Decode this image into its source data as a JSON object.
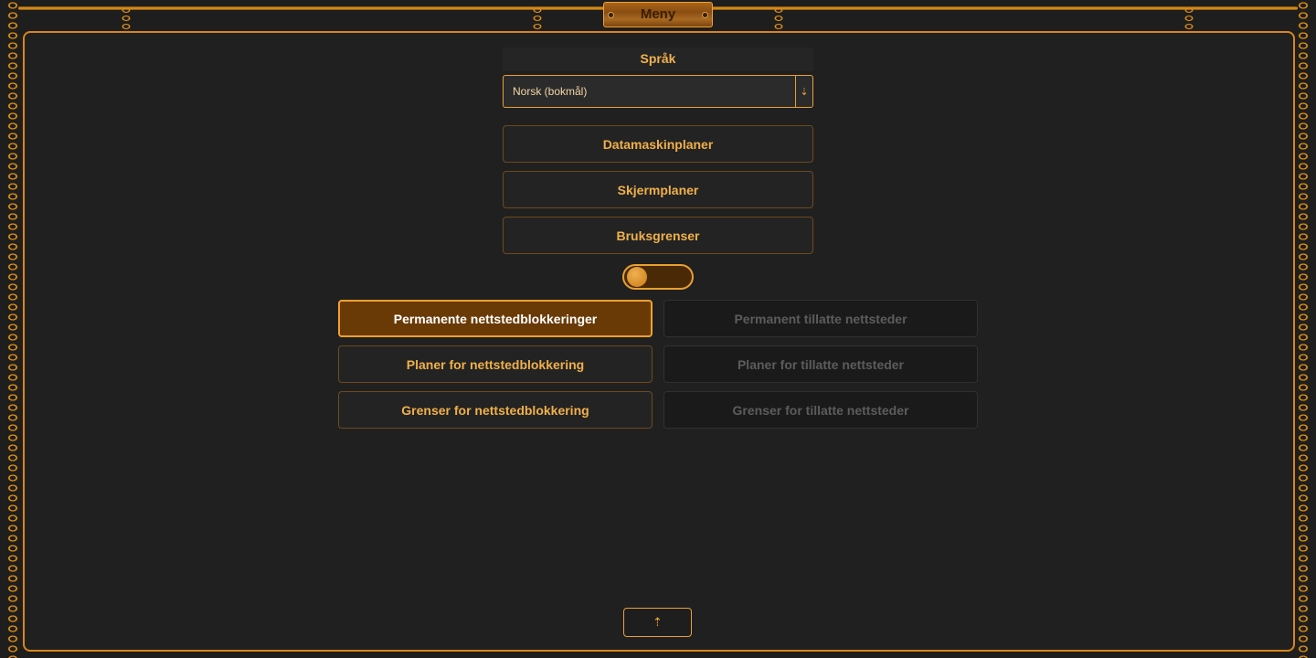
{
  "menu_title": "Meny",
  "language": {
    "header": "Språk",
    "selected": "Norsk (bokmål)",
    "arrow_icon": "⇣"
  },
  "main_buttons": {
    "computer_schedules": "Datamaskinplaner",
    "screen_schedules": "Skjermplaner",
    "usage_limits": "Bruksgrenser"
  },
  "toggle": {
    "state": "off"
  },
  "blocking": {
    "permanent_block": "Permanente nettstedblokkeringer",
    "block_schedules": "Planer for nettstedblokkering",
    "block_limits": "Grenser for nettstedblokkering"
  },
  "allowed": {
    "permanent_allow": "Permanent tillatte nettsteder",
    "allow_schedules": "Planer for tillatte nettsteder",
    "allow_limits": "Grenser for tillatte nettsteder"
  },
  "scroll_up_icon": "⇡",
  "colors": {
    "accent": "#e8a030",
    "background": "#1e1e1e",
    "active_fill": "#6a3a06",
    "disabled_text": "#5c5c5c"
  }
}
